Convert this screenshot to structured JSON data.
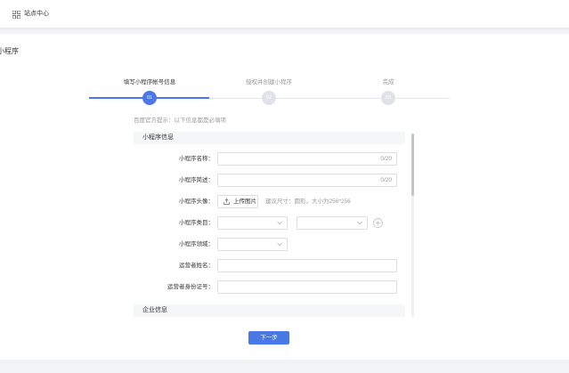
{
  "header": {
    "icon": "grid-icon",
    "site_center_label": "站点中心"
  },
  "page_title": "小程序",
  "current_step": 1,
  "steps": [
    {
      "number": "01",
      "label": "填写小程序帐号信息"
    },
    {
      "number": "02",
      "label": "授权并创建小程序"
    },
    {
      "number": "03",
      "label": "完成"
    }
  ],
  "notice": "百度官方提示：以下信息都是必填项",
  "sections": {
    "app_info": "小程序信息",
    "company_info": "企业信息"
  },
  "form": {
    "name": {
      "label": "小程序名称：",
      "value": "",
      "counter": "0/20"
    },
    "description": {
      "label": "小程序简述：",
      "value": "",
      "counter": "0/20"
    },
    "avatar": {
      "label": "小程序头像：",
      "upload_icon": "upload-icon",
      "upload_label": "上传图片",
      "hint": "建议尺寸：圆形，大小为256*256"
    },
    "category": {
      "label": "小程序类目：",
      "primary_value": "",
      "secondary_value": "",
      "add_icon": "plus-circle-icon"
    },
    "domain": {
      "label": "小程序领域：",
      "value": ""
    },
    "operator_name": {
      "label": "运营者姓名：",
      "value": ""
    },
    "operator_id": {
      "label": "运营者身份证号：",
      "value": ""
    }
  },
  "actions": {
    "next_label": "下一步"
  },
  "colors": {
    "accent": "#4a78e6",
    "step_pending": "#dfe2e8",
    "section_bg": "#f5f6f8"
  }
}
